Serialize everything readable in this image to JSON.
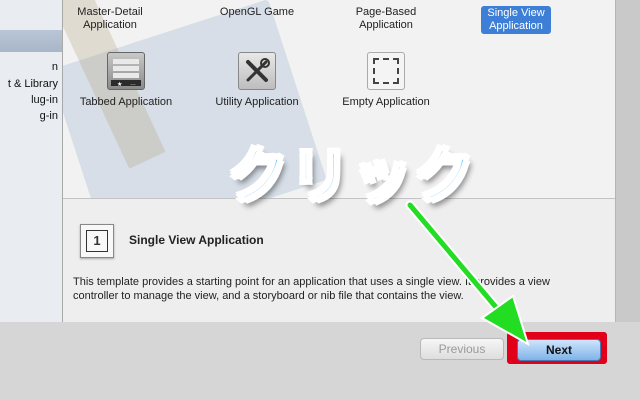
{
  "sidebar": {
    "items": [
      {
        "label": "n"
      },
      {
        "label": "t & Library"
      },
      {
        "label": "lug-in"
      },
      {
        "label": "g-in"
      }
    ]
  },
  "templates": [
    {
      "label_line1": "Master-Detail",
      "label_line2": "Application",
      "icon": "none",
      "selected": false
    },
    {
      "label_line1": "OpenGL Game",
      "label_line2": "",
      "icon": "none",
      "selected": false
    },
    {
      "label_line1": "Page-Based",
      "label_line2": "Application",
      "icon": "none",
      "selected": false
    },
    {
      "label_line1": "Single View",
      "label_line2": "Application",
      "icon": "none",
      "selected": true
    },
    {
      "label_line1": "Tabbed Application",
      "label_line2": "",
      "icon": "tabbed-app-icon",
      "selected": false
    },
    {
      "label_line1": "Utility Application",
      "label_line2": "",
      "icon": "tools-icon",
      "selected": false
    },
    {
      "label_line1": "Empty Application",
      "label_line2": "",
      "icon": "dashed-square-icon",
      "selected": false
    }
  ],
  "description": {
    "icon_number": "1",
    "title": "Single View Application",
    "text": "This template provides a starting point for an application that uses a single view. It provides a view controller to manage the view, and a storyboard or nib file that contains the view."
  },
  "footer": {
    "previous_label": "Previous",
    "next_label": "Next"
  },
  "annotation": {
    "text": "クリック",
    "text_color": "#2aa3ee",
    "arrow_color": "#22dd22",
    "highlight_color": "#e0001a"
  }
}
